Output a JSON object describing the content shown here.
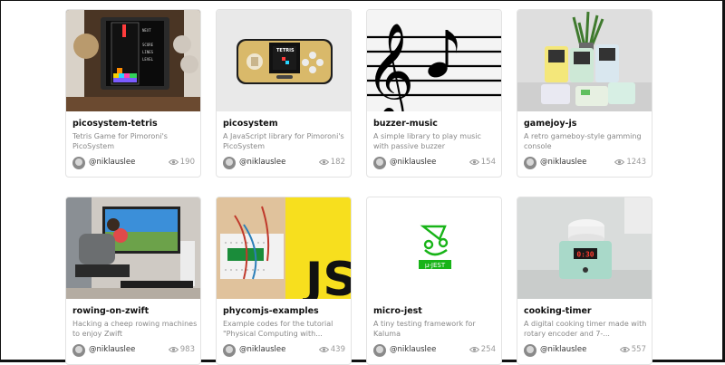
{
  "cards": [
    {
      "title": "picosystem-tetris",
      "desc": "Tetris Game for Pimoroni's PicoSystem",
      "author": "@niklauslee",
      "views": "190",
      "thumb": "tetris"
    },
    {
      "title": "picosystem",
      "desc": "A JavaScript library for Pimoroni's PicoSystem",
      "author": "@niklauslee",
      "views": "182",
      "thumb": "handheld"
    },
    {
      "title": "buzzer-music",
      "desc": "A simple library to play music with passive buzzer",
      "author": "@niklauslee",
      "views": "154",
      "thumb": "music"
    },
    {
      "title": "gamejoy-js",
      "desc": "A retro gameboy-style gamming console",
      "author": "@niklauslee",
      "views": "1243",
      "thumb": "gameboys"
    },
    {
      "title": "rowing-on-zwift",
      "desc": "Hacking a cheep rowing machines to enjoy Zwift",
      "author": "@niklauslee",
      "views": "983",
      "thumb": "rowing"
    },
    {
      "title": "phycomjs-examples",
      "desc": "Example codes for the tutorial \"Physical Computing with...",
      "author": "@niklauslee",
      "views": "439",
      "thumb": "js"
    },
    {
      "title": "micro-jest",
      "desc": "A tiny testing framework for Kaluma",
      "author": "@niklauslee",
      "views": "254",
      "thumb": "jest",
      "badge": "μ-JEST"
    },
    {
      "title": "cooking-timer",
      "desc": "A digital cooking timer made with rotary encoder and 7-...",
      "author": "@niklauslee",
      "views": "557",
      "thumb": "timer",
      "display": "0:30"
    }
  ]
}
